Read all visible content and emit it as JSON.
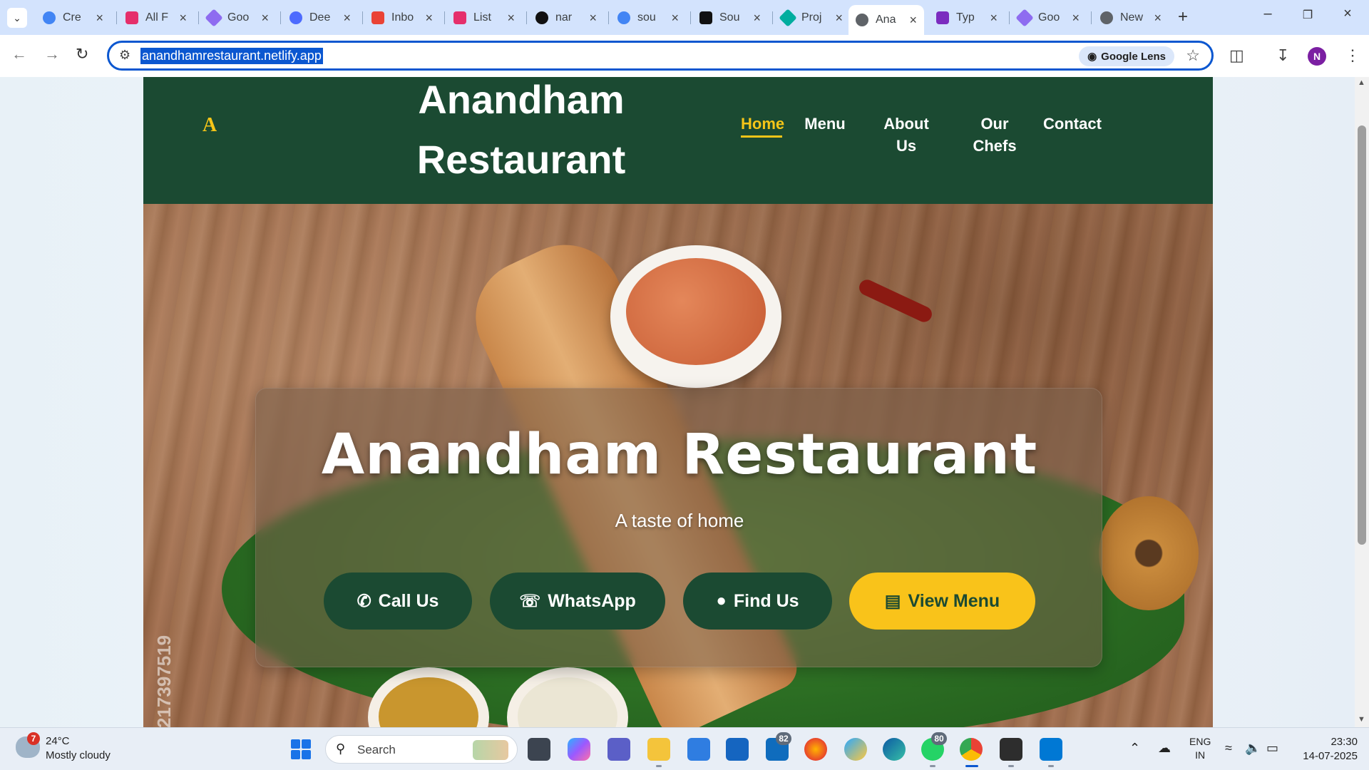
{
  "browser": {
    "tabs": [
      {
        "title": "Cre",
        "fav": "#4285f4",
        "icon": "google-icon"
      },
      {
        "title": "All F",
        "fav": "#e52f6b",
        "icon": "canva-icon"
      },
      {
        "title": "Goo",
        "fav": "#8e6cf0",
        "icon": "gemini-icon"
      },
      {
        "title": "Dee",
        "fav": "#4d6bfe",
        "icon": "deepseek-icon"
      },
      {
        "title": "Inbo",
        "fav": "#ea4335",
        "icon": "gmail-icon"
      },
      {
        "title": "List",
        "fav": "#e52f6b",
        "icon": "canva-icon"
      },
      {
        "title": "nar",
        "fav": "#111111",
        "icon": "github-icon"
      },
      {
        "title": "sou",
        "fav": "#4285f4",
        "icon": "google-icon"
      },
      {
        "title": "Sou",
        "fav": "#111111",
        "icon": "stackblitz-icon"
      },
      {
        "title": "Proj",
        "fav": "#00ad9f",
        "icon": "netlify-icon"
      },
      {
        "title": "Ana",
        "fav": "#5f6368",
        "icon": "globe-icon",
        "active": true
      },
      {
        "title": "Typ",
        "fav": "#7b2cbf",
        "icon": "qr-icon"
      },
      {
        "title": "Goo",
        "fav": "#8e6cf0",
        "icon": "gemini-icon"
      },
      {
        "title": "New",
        "fav": "#5f6368",
        "icon": "chrome-icon"
      }
    ],
    "url": "anandhamrestaurant.netlify.app",
    "lens_label": "Google Lens",
    "profile_initial": "N"
  },
  "site": {
    "logo_letter": "A",
    "brand_line1": "Anandham",
    "brand_line2": "Restaurant",
    "nav": [
      {
        "label": "Home",
        "active": true
      },
      {
        "label": "Menu"
      },
      {
        "label": "About Us"
      },
      {
        "label": "Our Chefs"
      },
      {
        "label": "Contact"
      }
    ],
    "hero": {
      "title": "Anandham Restaurant",
      "subtitle": "A taste of home",
      "watermark": "217397519",
      "buttons": [
        {
          "label": "Call Us",
          "icon": "phone-icon"
        },
        {
          "label": "WhatsApp",
          "icon": "whatsapp-icon"
        },
        {
          "label": "Find Us",
          "icon": "location-pin-icon"
        },
        {
          "label": "View Menu",
          "icon": "book-icon"
        }
      ]
    },
    "colors": {
      "header_green": "#1b4a32",
      "accent_yellow": "#f9c31a"
    }
  },
  "taskbar": {
    "weather_badge": "7",
    "weather_temp": "24°C",
    "weather_desc": "Mostly cloudy",
    "search_placeholder": "Search",
    "badges": {
      "outlook": "82",
      "whatsapp": "80"
    },
    "lang_line1": "ENG",
    "lang_line2": "IN",
    "time": "23:30",
    "date": "14-07-2025"
  }
}
